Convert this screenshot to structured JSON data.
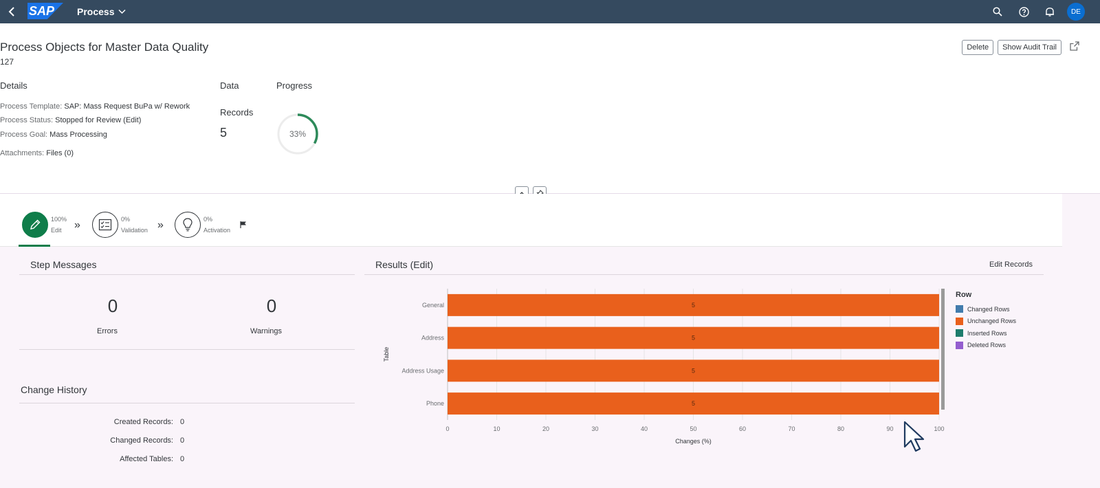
{
  "shell": {
    "app_title": "Process",
    "logo_text": "SAP",
    "user_initials": "DE"
  },
  "header": {
    "title": "Process Objects for Master Data Quality",
    "subtitle": "127",
    "actions": {
      "delete": "Delete",
      "audit_trail": "Show Audit Trail"
    },
    "details": {
      "heading": "Details",
      "template_label": "Process Template:",
      "template_value": "SAP: Mass Request BuPa w/ Rework",
      "status_label": "Process Status:",
      "status_value": "Stopped for Review (Edit)",
      "goal_label": "Process Goal:",
      "goal_value": "Mass Processing",
      "attach_label": "Attachments:",
      "attach_value": "Files (0)"
    },
    "data": {
      "heading": "Data",
      "records_label": "Records",
      "records_value": "5"
    },
    "progress": {
      "heading": "Progress",
      "value_text": "33%",
      "fraction": 0.33,
      "color": "#2d8a5a"
    }
  },
  "steps": [
    {
      "percent": "100%",
      "label": "Edit"
    },
    {
      "percent": "0%",
      "label": "Validation"
    },
    {
      "percent": "0%",
      "label": "Activation"
    }
  ],
  "step_messages": {
    "title": "Step Messages",
    "errors_value": "0",
    "errors_label": "Errors",
    "warnings_value": "0",
    "warnings_label": "Warnings"
  },
  "change_history": {
    "title": "Change History",
    "rows": [
      {
        "label": "Created Records:",
        "value": "0"
      },
      {
        "label": "Changed Records:",
        "value": "0"
      },
      {
        "label": "Affected Tables:",
        "value": "0"
      }
    ]
  },
  "results": {
    "title": "Results (Edit)",
    "edit_records": "Edit Records"
  },
  "chart_data": {
    "type": "bar",
    "orientation": "horizontal",
    "stacked": true,
    "categories": [
      "General",
      "Address",
      "Address Usage",
      "Phone"
    ],
    "series": [
      {
        "name": "Changed Rows",
        "values": [
          0,
          0,
          0,
          0
        ],
        "color": "#427cac"
      },
      {
        "name": "Unchanged Rows",
        "values": [
          100,
          100,
          100,
          100
        ],
        "labels": [
          "5",
          "5",
          "5",
          "5"
        ],
        "color": "#e9601c"
      },
      {
        "name": "Inserted Rows",
        "values": [
          0,
          0,
          0,
          0
        ],
        "color": "#1e7c6c"
      },
      {
        "name": "Deleted Rows",
        "values": [
          0,
          0,
          0,
          0
        ],
        "color": "#945ecf"
      }
    ],
    "xlabel": "Changes (%)",
    "ylabel": "Table",
    "xlim": [
      0,
      100
    ],
    "xticks": [
      0,
      10,
      20,
      30,
      40,
      50,
      60,
      70,
      80,
      90,
      100
    ],
    "legend_title": "Row",
    "legend_position": "right",
    "grid": true
  }
}
